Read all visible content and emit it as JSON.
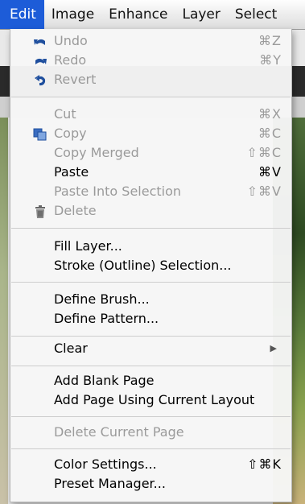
{
  "menubar": {
    "items": [
      {
        "label": "Edit"
      },
      {
        "label": "Image"
      },
      {
        "label": "Enhance"
      },
      {
        "label": "Layer"
      },
      {
        "label": "Select"
      }
    ]
  },
  "edit_menu": {
    "undo": {
      "label": "Undo",
      "shortcut": "⌘Z",
      "icon": "undo-arrow-icon"
    },
    "redo": {
      "label": "Redo",
      "shortcut": "⌘Y",
      "icon": "redo-arrow-icon"
    },
    "revert": {
      "label": "Revert",
      "icon": "revert-icon"
    },
    "cut": {
      "label": "Cut",
      "shortcut": "⌘X"
    },
    "copy": {
      "label": "Copy",
      "shortcut": "⌘C",
      "icon": "copy-icon"
    },
    "copy_merged": {
      "label": "Copy Merged",
      "shortcut": "⇧⌘C"
    },
    "paste": {
      "label": "Paste",
      "shortcut": "⌘V"
    },
    "paste_into": {
      "label": "Paste Into Selection",
      "shortcut": "⇧⌘V"
    },
    "delete": {
      "label": "Delete",
      "icon": "trash-icon"
    },
    "fill_layer": {
      "label": "Fill Layer..."
    },
    "stroke": {
      "label": "Stroke (Outline) Selection..."
    },
    "define_brush": {
      "label": "Define Brush..."
    },
    "define_pattern": {
      "label": "Define Pattern..."
    },
    "clear": {
      "label": "Clear",
      "submenu_arrow": "▶"
    },
    "add_blank_page": {
      "label": "Add Blank Page"
    },
    "add_page_layout": {
      "label": "Add Page Using Current Layout"
    },
    "delete_page": {
      "label": "Delete Current Page"
    },
    "color_settings": {
      "label": "Color Settings...",
      "shortcut": "⇧⌘K"
    },
    "preset_manager": {
      "label": "Preset Manager..."
    }
  },
  "colors": {
    "menubar_active": "#1d5cd8",
    "disabled_text": "#9a9a9a",
    "icon_blue": "#1f4f9e"
  }
}
